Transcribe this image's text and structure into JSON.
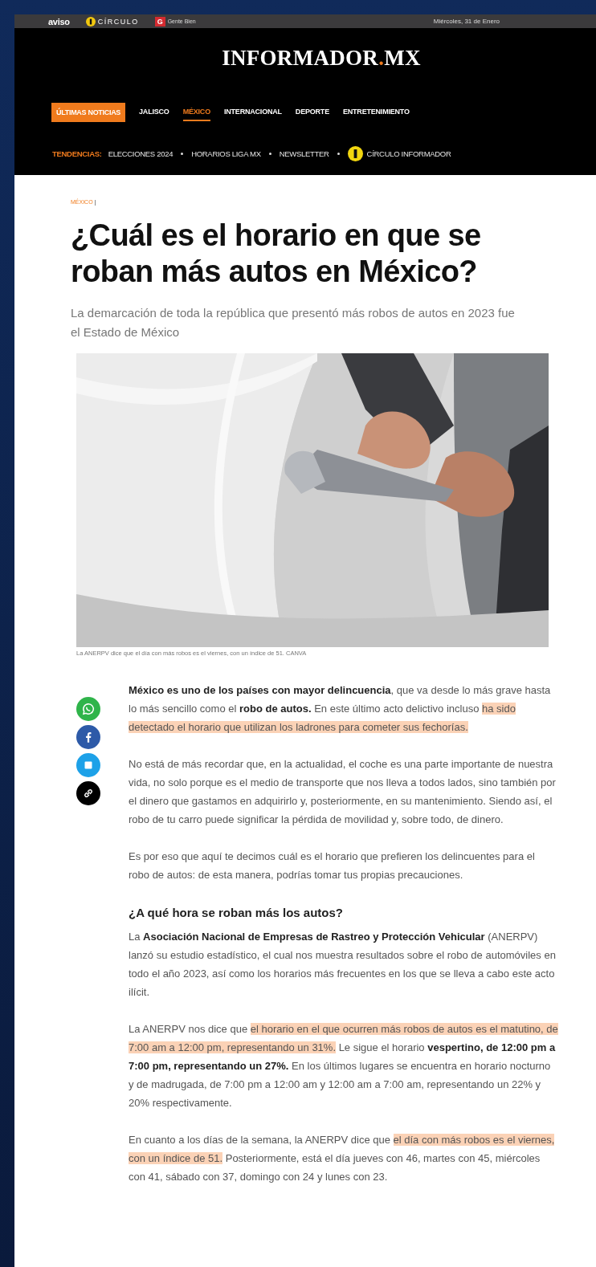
{
  "top_bar": {
    "brands": [
      {
        "kind": "aviso",
        "text": "aviso"
      },
      {
        "kind": "circulo",
        "text": "CÍRCULO"
      },
      {
        "kind": "gente",
        "text": "Gente Bien",
        "mark": "G"
      }
    ],
    "date": "Miércoles, 31 de Enero"
  },
  "masthead": {
    "parts": [
      {
        "text": "INFORMADOR",
        "accent": false
      },
      {
        "text": ".",
        "accent": true
      },
      {
        "text": "MX",
        "accent": false
      }
    ]
  },
  "nav": [
    {
      "label": "ÚLTIMAS NOTICIAS",
      "kind": "badge",
      "selected": false
    },
    {
      "label": "JALISCO",
      "kind": "link",
      "selected": false
    },
    {
      "label": "MÉXICO",
      "kind": "link",
      "selected": true
    },
    {
      "label": "INTERNACIONAL",
      "kind": "link",
      "selected": false
    },
    {
      "label": "DEPORTE",
      "kind": "link",
      "selected": false
    },
    {
      "label": "ENTRETENIMIENTO",
      "kind": "link",
      "selected": false
    }
  ],
  "trends": {
    "label": "TENDENCIAS:",
    "items": [
      {
        "text": "ELECCIONES 2024",
        "kind": "plain"
      },
      {
        "text": "HORARIOS LIGA MX",
        "kind": "plain"
      },
      {
        "text": "NEWSLETTER",
        "kind": "plain"
      },
      {
        "text": "CÍRCULO INFORMADOR",
        "kind": "circulo"
      }
    ]
  },
  "article": {
    "section": "MÉXICO",
    "section_separator": "|",
    "title": "¿Cuál es el horario en que se roban más autos en México?",
    "subtitle": "La demarcación de toda la república que presentó más robos de autos en 2023 fue el Estado de México",
    "image": {
      "kind": "picture",
      "caption": "La ANERPV dice que el día con más robos es el viernes, con un índice de 51. CANVA"
    },
    "share": [
      {
        "kind": "whatsapp"
      },
      {
        "kind": "facebook"
      },
      {
        "kind": "twitter"
      },
      {
        "kind": "link"
      }
    ],
    "body": [
      {
        "kind": "paragraph",
        "segments": [
          {
            "text": "México es uno de los países con mayor delincuencia",
            "bold": true,
            "highlighted": false
          },
          {
            "text": ", que va desde lo más grave hasta lo más sencillo como el ",
            "bold": false,
            "highlighted": false
          },
          {
            "text": "robo de autos.",
            "bold": true,
            "highlighted": false
          },
          {
            "text": " En este último acto delictivo incluso ",
            "bold": false,
            "highlighted": false
          },
          {
            "text": "ha sido detectado el horario que utilizan los ladrones para cometer sus fechorías.",
            "bold": false,
            "highlighted": true
          }
        ]
      },
      {
        "kind": "paragraph",
        "segments": [
          {
            "text": "No está de más recordar que, en la actualidad, el coche es una parte importante de nuestra vida, no solo porque es el medio de transporte que nos lleva a todos lados, sino también por el dinero que gastamos en adquirirlo y, posteriormente, en su mantenimiento. Siendo así, el robo de tu carro puede significar la pérdida de movilidad y, sobre todo, de dinero.",
            "bold": false,
            "highlighted": false
          }
        ]
      },
      {
        "kind": "paragraph",
        "segments": [
          {
            "text": "Es por eso que aquí te decimos cuál es el horario que prefieren los delincuentes para el robo de autos: de esta manera, podrías tomar tus propias precauciones.",
            "bold": false,
            "highlighted": false
          }
        ]
      },
      {
        "kind": "heading",
        "segments": [
          {
            "text": "¿A qué hora se roban más los autos?",
            "bold": true,
            "highlighted": false
          }
        ]
      },
      {
        "kind": "paragraph",
        "segments": [
          {
            "text": "La ",
            "bold": false,
            "highlighted": false
          },
          {
            "text": "Asociación Nacional de Empresas de Rastreo y Protección Vehicular",
            "bold": true,
            "highlighted": false
          },
          {
            "text": " (ANERPV) lanzó su estudio estadístico, el cual nos muestra resultados sobre el robo de automóviles en todo el año 2023, así como los horarios más frecuentes en los que se lleva a cabo este acto ilícit.",
            "bold": false,
            "highlighted": false
          }
        ]
      },
      {
        "kind": "paragraph",
        "segments": [
          {
            "text": "La ANERPV nos dice que ",
            "bold": false,
            "highlighted": false
          },
          {
            "text": "el horario en el que ocurren más robos de autos es el matutino, de 7:00 am a 12:00 pm, representando un 31%.",
            "bold": false,
            "highlighted": true
          },
          {
            "text": " Le sigue el horario ",
            "bold": false,
            "highlighted": false
          },
          {
            "text": "vespertino, de 12:00 pm a 7:00 pm, representando un 27%.",
            "bold": true,
            "highlighted": false
          },
          {
            "text": " En los últimos lugares se encuentra en horario nocturno y de madrugada, de 7:00 pm a 12:00 am y 12:00 am a 7:00 am, representando un 22% y 20% respectivamente.",
            "bold": false,
            "highlighted": false
          }
        ]
      },
      {
        "kind": "paragraph",
        "segments": [
          {
            "text": "En cuanto a los días de la semana, la ANERPV dice que ",
            "bold": false,
            "highlighted": false
          },
          {
            "text": "el día con más robos es el viernes, con un índice de 51.",
            "bold": false,
            "highlighted": true
          },
          {
            "text": " Posteriormente, está el día jueves con 46, martes con 45, miércoles con 41, sábado con 37, domingo con 24 y lunes con 23.",
            "bold": false,
            "highlighted": false
          }
        ]
      }
    ]
  }
}
